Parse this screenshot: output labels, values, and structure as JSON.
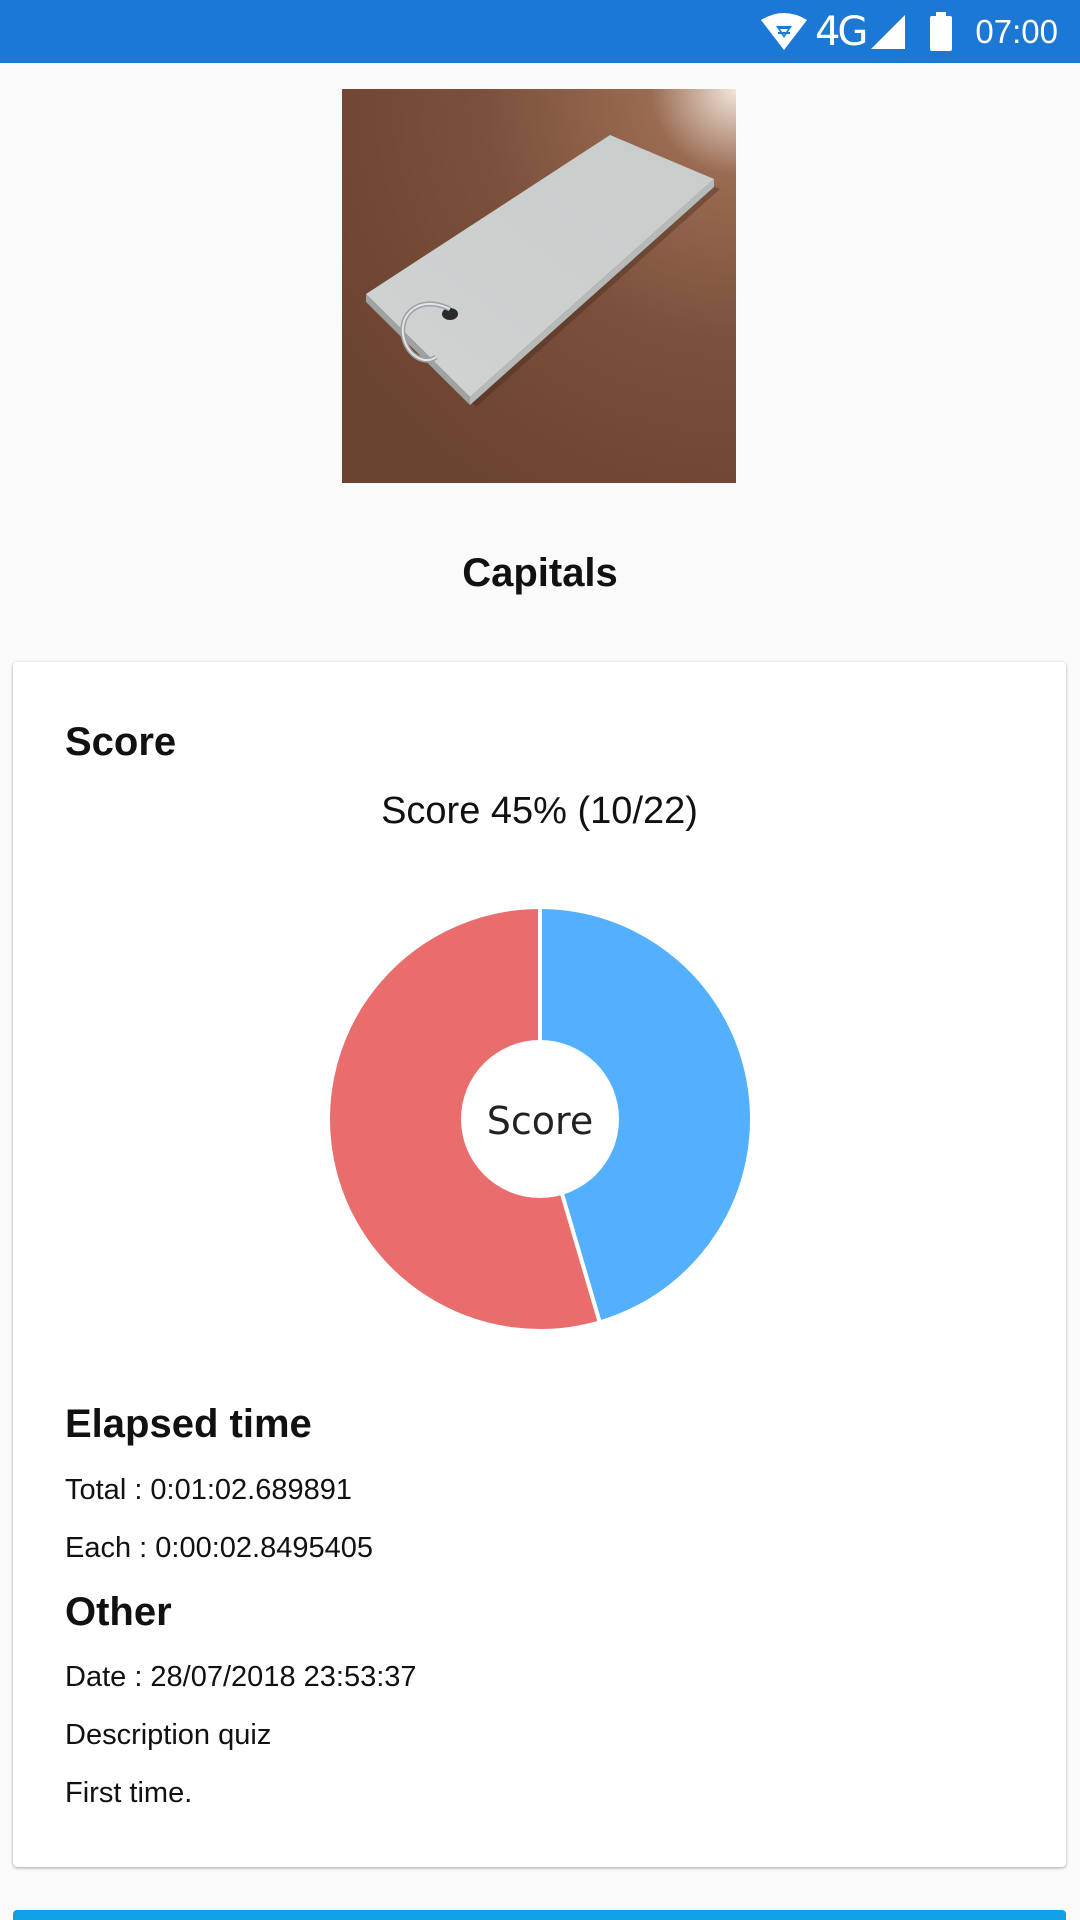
{
  "status_bar": {
    "network": "4G",
    "time": "07:00"
  },
  "quiz": {
    "title": "Capitals",
    "image_alt": "key-tag-card-icon"
  },
  "score_section": {
    "heading": "Score",
    "caption": "Score 45% (10/22)",
    "chart_center_label": "Score"
  },
  "chart_data": {
    "type": "pie",
    "style": "donut",
    "title": "",
    "slices": [
      {
        "label": "",
        "value": 10,
        "color": "#52b0ff"
      },
      {
        "label": "",
        "value": 12,
        "color": "#e96d6d"
      }
    ],
    "center_label": "Score"
  },
  "elapsed_section": {
    "heading": "Elapsed time",
    "total": "Total : 0:01:02.689891",
    "each": "Each : 0:00:02.8495405"
  },
  "other_section": {
    "heading": "Other",
    "date": "Date : 28/07/2018 23:53:37",
    "description": "Description quiz",
    "note": "First time."
  },
  "colors": {
    "status_bar": "#1b78d4",
    "correct": "#52b0ff",
    "incorrect": "#e96d6d",
    "bottom_button": "#10a0e8"
  }
}
